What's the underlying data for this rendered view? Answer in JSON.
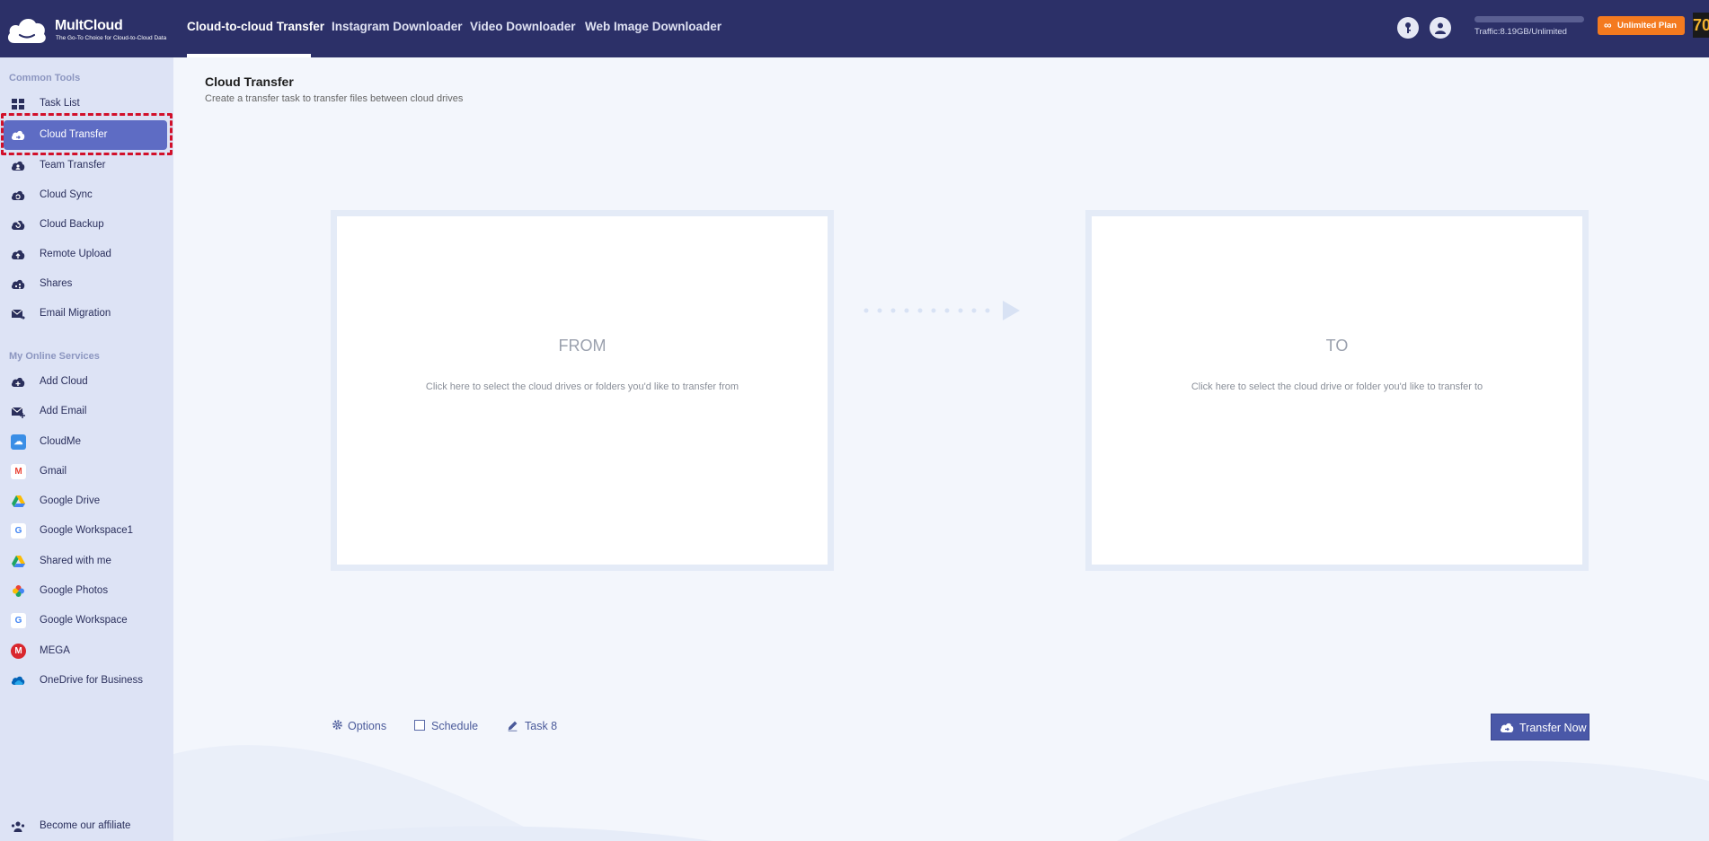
{
  "brand": {
    "name": "MultCloud",
    "tagline": "The Go-To Choice for Cloud-to-Cloud Data"
  },
  "nav": {
    "items": [
      {
        "label": "Cloud-to-cloud Transfer",
        "active": true
      },
      {
        "label": "Instagram Downloader"
      },
      {
        "label": "Video Downloader"
      },
      {
        "label": "Web Image Downloader"
      }
    ]
  },
  "header": {
    "traffic": "Traffic:8.19GB/Unlimited",
    "plan_label": "Unlimited Plan",
    "plan_symbol": "∞",
    "corner_badge": "70"
  },
  "sidebar": {
    "common_title": "Common Tools",
    "common_items": [
      {
        "label": "Task List",
        "icon": "grid-icon"
      },
      {
        "label": "Cloud Transfer",
        "icon": "cloud-transfer-icon",
        "active": true
      },
      {
        "label": "Team Transfer",
        "icon": "team-transfer-icon"
      },
      {
        "label": "Cloud Sync",
        "icon": "cloud-sync-icon"
      },
      {
        "label": "Cloud Backup",
        "icon": "cloud-backup-icon"
      },
      {
        "label": "Remote Upload",
        "icon": "remote-upload-icon"
      },
      {
        "label": "Shares",
        "icon": "share-icon"
      },
      {
        "label": "Email Migration",
        "icon": "email-migration-icon"
      }
    ],
    "services_title": "My Online Services",
    "service_items": [
      {
        "label": "Add Cloud",
        "icon": "add-cloud-icon"
      },
      {
        "label": "Add Email",
        "icon": "add-email-icon"
      },
      {
        "label": "CloudMe",
        "icon": "cloudme-icon",
        "color": "#3a8ee6"
      },
      {
        "label": "Gmail",
        "icon": "gmail-icon",
        "color": "#ea4335"
      },
      {
        "label": "Google Drive",
        "icon": "google-drive-icon",
        "color": "#1fa463"
      },
      {
        "label": "Google Workspace1",
        "icon": "google-icon",
        "color": "#4285f4"
      },
      {
        "label": "Shared with me",
        "icon": "google-drive-icon",
        "color": "#1fa463"
      },
      {
        "label": "Google Photos",
        "icon": "google-photos-icon",
        "color": "#fbbc04"
      },
      {
        "label": "Google Workspace",
        "icon": "google-icon",
        "color": "#4285f4"
      },
      {
        "label": "MEGA",
        "icon": "mega-icon",
        "color": "#d9272e"
      },
      {
        "label": "OneDrive for Business",
        "icon": "onedrive-icon",
        "color": "#0364b8"
      }
    ],
    "affiliate_label": "Become our affiliate"
  },
  "main": {
    "title": "Cloud Transfer",
    "subtitle": "Create a transfer task to transfer files between cloud drives",
    "from_title": "FROM",
    "from_hint": "Click here to select the cloud drives or folders you'd like to transfer from",
    "to_title": "TO",
    "to_hint": "Click here to select the cloud drive or folder you'd like to transfer to",
    "options_label": "Options",
    "schedule_label": "Schedule",
    "task_label": "Task 8",
    "transfer_label": "Transfer Now"
  }
}
